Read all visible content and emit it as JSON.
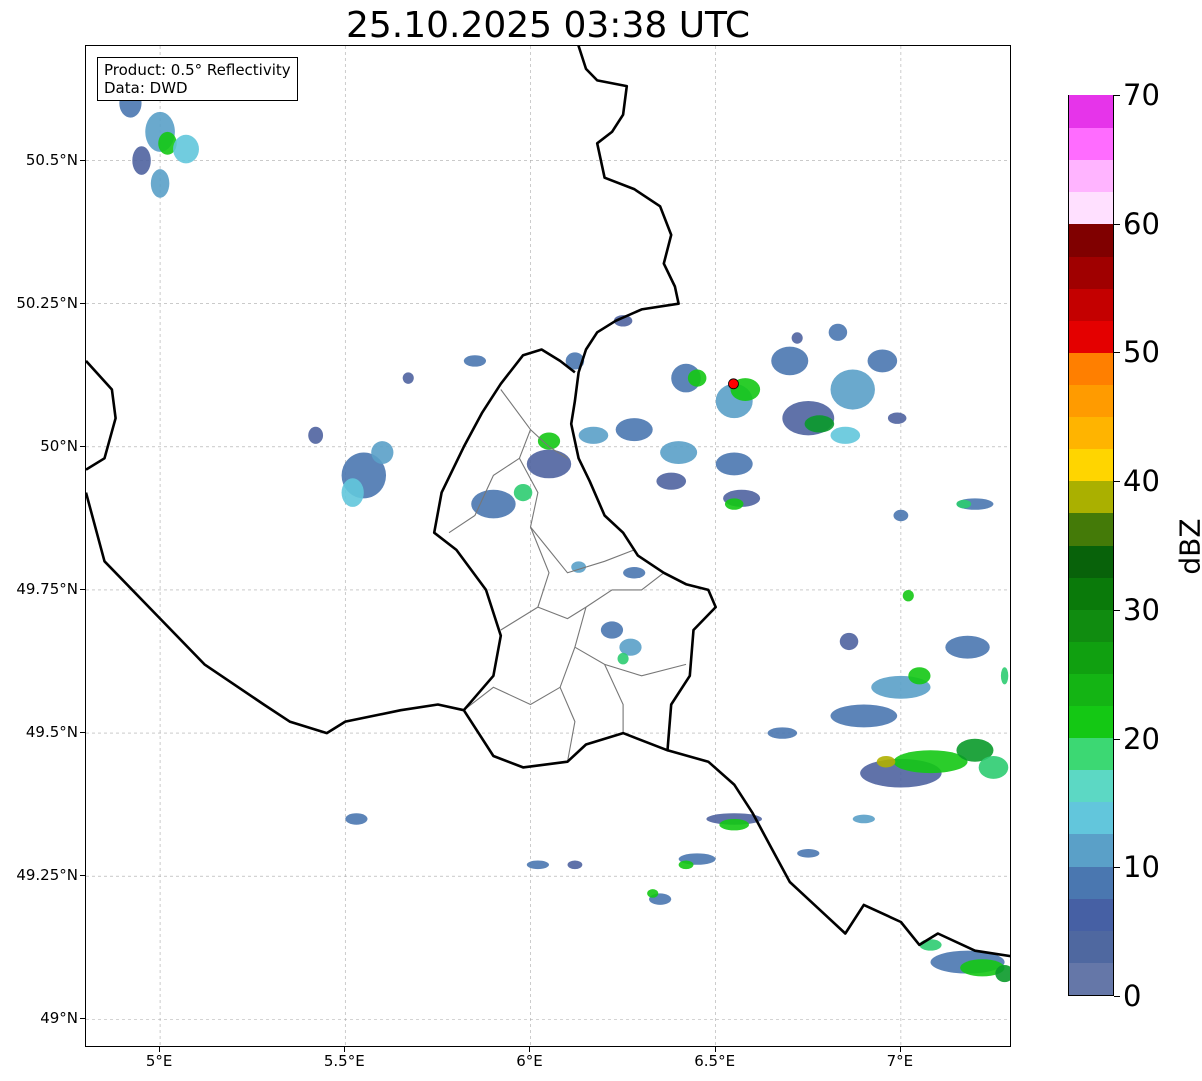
{
  "title": "25.10.2025 03:38 UTC",
  "info": {
    "product": "Product: 0.5° Reflectivity",
    "data": "Data: DWD"
  },
  "map": {
    "extent": {
      "lon_min": 4.8,
      "lon_max": 7.3,
      "lat_min": 48.95,
      "lat_max": 50.7
    },
    "lat_ticks": [
      {
        "value": 50.5,
        "label": "50.5°N"
      },
      {
        "value": 50.25,
        "label": "50.25°N"
      },
      {
        "value": 50.0,
        "label": "50°N"
      },
      {
        "value": 49.75,
        "label": "49.75°N"
      },
      {
        "value": 49.5,
        "label": "49.5°N"
      },
      {
        "value": 49.25,
        "label": "49.25°N"
      },
      {
        "value": 49.0,
        "label": "49°N"
      }
    ],
    "lon_ticks": [
      {
        "value": 5.0,
        "label": "5°E"
      },
      {
        "value": 5.5,
        "label": "5.5°E"
      },
      {
        "value": 6.0,
        "label": "6°E"
      },
      {
        "value": 6.5,
        "label": "6.5°E"
      },
      {
        "value": 7.0,
        "label": "7°E"
      }
    ],
    "gridlines": true,
    "radar_site": {
      "lon": 6.548,
      "lat": 50.11,
      "color": "#ff0000"
    },
    "national_borders": [
      [
        [
          6.12,
          50.72
        ],
        [
          6.15,
          50.66
        ],
        [
          6.18,
          50.64
        ],
        [
          6.26,
          50.63
        ],
        [
          6.25,
          50.58
        ],
        [
          6.22,
          50.55
        ],
        [
          6.18,
          50.53
        ],
        [
          6.2,
          50.47
        ],
        [
          6.28,
          50.45
        ],
        [
          6.35,
          50.42
        ],
        [
          6.38,
          50.37
        ],
        [
          6.36,
          50.32
        ],
        [
          6.39,
          50.28
        ],
        [
          6.4,
          50.25
        ],
        [
          6.3,
          50.24
        ],
        [
          6.23,
          50.22
        ],
        [
          6.18,
          50.2
        ],
        [
          6.15,
          50.17
        ],
        [
          6.13,
          50.13
        ],
        [
          6.12,
          50.08
        ],
        [
          6.11,
          50.04
        ],
        [
          6.13,
          49.98
        ],
        [
          6.16,
          49.94
        ],
        [
          6.2,
          49.88
        ],
        [
          6.25,
          49.85
        ],
        [
          6.29,
          49.81
        ],
        [
          6.36,
          49.78
        ],
        [
          6.42,
          49.76
        ],
        [
          6.48,
          49.75
        ],
        [
          6.5,
          49.72
        ],
        [
          6.44,
          49.68
        ],
        [
          6.43,
          49.6
        ],
        [
          6.38,
          49.55
        ],
        [
          6.37,
          49.47
        ],
        [
          6.25,
          49.5
        ],
        [
          6.15,
          49.48
        ],
        [
          6.1,
          49.45
        ],
        [
          5.98,
          49.44
        ],
        [
          5.9,
          49.46
        ],
        [
          5.82,
          49.54
        ],
        [
          5.75,
          49.55
        ],
        [
          5.65,
          49.54
        ],
        [
          5.5,
          49.52
        ],
        [
          5.45,
          49.5
        ],
        [
          5.35,
          49.52
        ],
        [
          5.28,
          49.55
        ],
        [
          5.12,
          49.62
        ],
        [
          5.0,
          49.7
        ],
        [
          4.85,
          49.8
        ],
        [
          4.8,
          49.92
        ]
      ],
      [
        [
          4.8,
          50.15
        ],
        [
          4.87,
          50.1
        ],
        [
          4.88,
          50.05
        ],
        [
          4.85,
          49.98
        ],
        [
          4.8,
          49.96
        ]
      ],
      [
        [
          5.82,
          49.54
        ],
        [
          5.9,
          49.6
        ],
        [
          5.92,
          49.67
        ],
        [
          5.88,
          49.75
        ],
        [
          5.8,
          49.82
        ],
        [
          5.74,
          49.85
        ],
        [
          5.76,
          49.92
        ],
        [
          5.82,
          50.0
        ],
        [
          5.87,
          50.06
        ],
        [
          5.92,
          50.11
        ],
        [
          5.98,
          50.16
        ],
        [
          6.03,
          50.17
        ],
        [
          6.08,
          50.15
        ],
        [
          6.12,
          50.13
        ]
      ],
      [
        [
          6.37,
          49.47
        ],
        [
          6.48,
          49.45
        ],
        [
          6.55,
          49.41
        ],
        [
          6.6,
          49.36
        ],
        [
          6.65,
          49.3
        ],
        [
          6.7,
          49.24
        ],
        [
          6.8,
          49.18
        ],
        [
          6.85,
          49.15
        ],
        [
          6.9,
          49.2
        ],
        [
          7.0,
          49.17
        ],
        [
          7.05,
          49.13
        ],
        [
          7.1,
          49.15
        ],
        [
          7.2,
          49.12
        ],
        [
          7.3,
          49.11
        ]
      ]
    ],
    "regional_borders": [
      [
        [
          5.92,
          50.1
        ],
        [
          6.0,
          50.03
        ],
        [
          5.97,
          49.98
        ],
        [
          5.9,
          49.95
        ],
        [
          5.85,
          49.88
        ],
        [
          5.78,
          49.85
        ]
      ],
      [
        [
          6.0,
          50.03
        ],
        [
          6.05,
          50.0
        ],
        [
          6.1,
          49.98
        ]
      ],
      [
        [
          5.97,
          49.98
        ],
        [
          6.02,
          49.92
        ],
        [
          6.0,
          49.86
        ],
        [
          6.05,
          49.82
        ],
        [
          6.1,
          49.78
        ],
        [
          6.2,
          49.8
        ],
        [
          6.28,
          49.82
        ]
      ],
      [
        [
          6.0,
          49.86
        ],
        [
          6.05,
          49.78
        ],
        [
          6.02,
          49.72
        ],
        [
          5.92,
          49.68
        ]
      ],
      [
        [
          6.02,
          49.72
        ],
        [
          6.1,
          49.7
        ],
        [
          6.15,
          49.72
        ],
        [
          6.22,
          49.75
        ],
        [
          6.3,
          49.75
        ],
        [
          6.36,
          49.78
        ]
      ],
      [
        [
          6.15,
          49.72
        ],
        [
          6.12,
          49.65
        ],
        [
          6.08,
          49.58
        ],
        [
          6.0,
          49.55
        ],
        [
          5.9,
          49.58
        ],
        [
          5.82,
          49.54
        ]
      ],
      [
        [
          6.12,
          49.65
        ],
        [
          6.2,
          49.62
        ],
        [
          6.3,
          49.6
        ],
        [
          6.42,
          49.62
        ]
      ],
      [
        [
          6.08,
          49.58
        ],
        [
          6.12,
          49.52
        ],
        [
          6.1,
          49.45
        ]
      ],
      [
        [
          6.2,
          49.62
        ],
        [
          6.25,
          49.55
        ],
        [
          6.25,
          49.5
        ]
      ]
    ],
    "echoes": [
      {
        "lon": 4.92,
        "lat": 50.6,
        "w": 0.06,
        "h": 0.05,
        "c": "#4a77b0"
      },
      {
        "lon": 5.0,
        "lat": 50.55,
        "w": 0.08,
        "h": 0.07,
        "c": "#5aa0c8"
      },
      {
        "lon": 5.02,
        "lat": 50.53,
        "w": 0.05,
        "h": 0.04,
        "c": "#14c814"
      },
      {
        "lon": 5.07,
        "lat": 50.52,
        "w": 0.07,
        "h": 0.05,
        "c": "#62c6dc"
      },
      {
        "lon": 4.95,
        "lat": 50.5,
        "w": 0.05,
        "h": 0.05,
        "c": "#4f63a0"
      },
      {
        "lon": 5.0,
        "lat": 50.46,
        "w": 0.05,
        "h": 0.05,
        "c": "#5aa0c8"
      },
      {
        "lon": 5.55,
        "lat": 49.95,
        "w": 0.12,
        "h": 0.08,
        "c": "#4a77b0"
      },
      {
        "lon": 5.52,
        "lat": 49.92,
        "w": 0.06,
        "h": 0.05,
        "c": "#62c6dc"
      },
      {
        "lon": 5.6,
        "lat": 49.99,
        "w": 0.06,
        "h": 0.04,
        "c": "#5aa0c8"
      },
      {
        "lon": 5.42,
        "lat": 50.02,
        "w": 0.04,
        "h": 0.03,
        "c": "#4f63a0"
      },
      {
        "lon": 5.85,
        "lat": 50.15,
        "w": 0.06,
        "h": 0.02,
        "c": "#4a77b0"
      },
      {
        "lon": 5.67,
        "lat": 50.12,
        "w": 0.03,
        "h": 0.02,
        "c": "#4f63a0"
      },
      {
        "lon": 5.9,
        "lat": 49.9,
        "w": 0.12,
        "h": 0.05,
        "c": "#4a77b0"
      },
      {
        "lon": 5.98,
        "lat": 49.92,
        "w": 0.05,
        "h": 0.03,
        "c": "#2ecc71"
      },
      {
        "lon": 6.05,
        "lat": 49.97,
        "w": 0.12,
        "h": 0.05,
        "c": "#4f63a0"
      },
      {
        "lon": 6.05,
        "lat": 50.01,
        "w": 0.06,
        "h": 0.03,
        "c": "#14c814"
      },
      {
        "lon": 6.17,
        "lat": 50.02,
        "w": 0.08,
        "h": 0.03,
        "c": "#5aa0c8"
      },
      {
        "lon": 6.12,
        "lat": 50.15,
        "w": 0.05,
        "h": 0.03,
        "c": "#4a77b0"
      },
      {
        "lon": 6.25,
        "lat": 50.22,
        "w": 0.05,
        "h": 0.02,
        "c": "#4f63a0"
      },
      {
        "lon": 6.28,
        "lat": 50.03,
        "w": 0.1,
        "h": 0.04,
        "c": "#4a77b0"
      },
      {
        "lon": 6.4,
        "lat": 49.99,
        "w": 0.1,
        "h": 0.04,
        "c": "#5aa0c8"
      },
      {
        "lon": 6.38,
        "lat": 49.94,
        "w": 0.08,
        "h": 0.03,
        "c": "#4f63a0"
      },
      {
        "lon": 6.55,
        "lat": 49.97,
        "w": 0.1,
        "h": 0.04,
        "c": "#4a77b0"
      },
      {
        "lon": 6.57,
        "lat": 49.91,
        "w": 0.1,
        "h": 0.03,
        "c": "#4f63a0"
      },
      {
        "lon": 6.55,
        "lat": 49.9,
        "w": 0.05,
        "h": 0.02,
        "c": "#14c814"
      },
      {
        "lon": 6.42,
        "lat": 50.12,
        "w": 0.08,
        "h": 0.05,
        "c": "#4a77b0"
      },
      {
        "lon": 6.45,
        "lat": 50.12,
        "w": 0.05,
        "h": 0.03,
        "c": "#14c814"
      },
      {
        "lon": 6.55,
        "lat": 50.08,
        "w": 0.1,
        "h": 0.06,
        "c": "#5aa0c8"
      },
      {
        "lon": 6.58,
        "lat": 50.1,
        "w": 0.08,
        "h": 0.04,
        "c": "#14c814"
      },
      {
        "lon": 6.7,
        "lat": 50.15,
        "w": 0.1,
        "h": 0.05,
        "c": "#4a77b0"
      },
      {
        "lon": 6.75,
        "lat": 50.05,
        "w": 0.14,
        "h": 0.06,
        "c": "#4f63a0"
      },
      {
        "lon": 6.78,
        "lat": 50.04,
        "w": 0.08,
        "h": 0.03,
        "c": "#0a9a2a"
      },
      {
        "lon": 6.87,
        "lat": 50.1,
        "w": 0.12,
        "h": 0.07,
        "c": "#5aa0c8"
      },
      {
        "lon": 6.85,
        "lat": 50.02,
        "w": 0.08,
        "h": 0.03,
        "c": "#62c6dc"
      },
      {
        "lon": 6.95,
        "lat": 50.15,
        "w": 0.08,
        "h": 0.04,
        "c": "#4a77b0"
      },
      {
        "lon": 6.99,
        "lat": 50.05,
        "w": 0.05,
        "h": 0.02,
        "c": "#4f63a0"
      },
      {
        "lon": 6.28,
        "lat": 49.78,
        "w": 0.06,
        "h": 0.02,
        "c": "#4a77b0"
      },
      {
        "lon": 6.13,
        "lat": 49.79,
        "w": 0.04,
        "h": 0.02,
        "c": "#5aa0c8"
      },
      {
        "lon": 6.22,
        "lat": 49.68,
        "w": 0.06,
        "h": 0.03,
        "c": "#4a77b0"
      },
      {
        "lon": 6.27,
        "lat": 49.65,
        "w": 0.06,
        "h": 0.03,
        "c": "#5aa0c8"
      },
      {
        "lon": 6.25,
        "lat": 49.63,
        "w": 0.03,
        "h": 0.02,
        "c": "#2ecc71"
      },
      {
        "lon": 6.9,
        "lat": 49.53,
        "w": 0.18,
        "h": 0.04,
        "c": "#4a77b0"
      },
      {
        "lon": 7.0,
        "lat": 49.58,
        "w": 0.16,
        "h": 0.04,
        "c": "#5aa0c8"
      },
      {
        "lon": 7.05,
        "lat": 49.6,
        "w": 0.06,
        "h": 0.03,
        "c": "#14c814"
      },
      {
        "lon": 7.18,
        "lat": 49.65,
        "w": 0.12,
        "h": 0.04,
        "c": "#4a77b0"
      },
      {
        "lon": 6.86,
        "lat": 49.66,
        "w": 0.05,
        "h": 0.03,
        "c": "#4f63a0"
      },
      {
        "lon": 7.0,
        "lat": 49.43,
        "w": 0.22,
        "h": 0.05,
        "c": "#4f63a0"
      },
      {
        "lon": 7.08,
        "lat": 49.45,
        "w": 0.2,
        "h": 0.04,
        "c": "#14c814"
      },
      {
        "lon": 7.2,
        "lat": 49.47,
        "w": 0.1,
        "h": 0.04,
        "c": "#0a9a2a"
      },
      {
        "lon": 6.96,
        "lat": 49.45,
        "w": 0.05,
        "h": 0.02,
        "c": "#b0b000"
      },
      {
        "lon": 7.25,
        "lat": 49.44,
        "w": 0.08,
        "h": 0.04,
        "c": "#2ecc71"
      },
      {
        "lon": 6.68,
        "lat": 49.5,
        "w": 0.08,
        "h": 0.02,
        "c": "#4a77b0"
      },
      {
        "lon": 6.55,
        "lat": 49.35,
        "w": 0.15,
        "h": 0.02,
        "c": "#4f63a0"
      },
      {
        "lon": 6.55,
        "lat": 49.34,
        "w": 0.08,
        "h": 0.02,
        "c": "#14c814"
      },
      {
        "lon": 6.45,
        "lat": 49.28,
        "w": 0.1,
        "h": 0.02,
        "c": "#4a77b0"
      },
      {
        "lon": 6.42,
        "lat": 49.27,
        "w": 0.04,
        "h": 0.015,
        "c": "#14c814"
      },
      {
        "lon": 6.35,
        "lat": 49.21,
        "w": 0.06,
        "h": 0.02,
        "c": "#4a77b0"
      },
      {
        "lon": 6.33,
        "lat": 49.22,
        "w": 0.03,
        "h": 0.015,
        "c": "#14c814"
      },
      {
        "lon": 6.75,
        "lat": 49.29,
        "w": 0.06,
        "h": 0.015,
        "c": "#4a77b0"
      },
      {
        "lon": 6.9,
        "lat": 49.35,
        "w": 0.06,
        "h": 0.015,
        "c": "#5aa0c8"
      },
      {
        "lon": 7.18,
        "lat": 49.1,
        "w": 0.2,
        "h": 0.04,
        "c": "#4a77b0"
      },
      {
        "lon": 7.22,
        "lat": 49.09,
        "w": 0.12,
        "h": 0.03,
        "c": "#14c814"
      },
      {
        "lon": 7.28,
        "lat": 49.08,
        "w": 0.05,
        "h": 0.03,
        "c": "#0a9a2a"
      },
      {
        "lon": 7.08,
        "lat": 49.13,
        "w": 0.06,
        "h": 0.02,
        "c": "#2ecc71"
      },
      {
        "lon": 5.53,
        "lat": 49.35,
        "w": 0.06,
        "h": 0.02,
        "c": "#4a77b0"
      },
      {
        "lon": 6.02,
        "lat": 49.27,
        "w": 0.06,
        "h": 0.015,
        "c": "#4a77b0"
      },
      {
        "lon": 6.12,
        "lat": 49.27,
        "w": 0.04,
        "h": 0.015,
        "c": "#4f63a0"
      },
      {
        "lon": 7.02,
        "lat": 49.74,
        "w": 0.03,
        "h": 0.02,
        "c": "#14c814"
      },
      {
        "lon": 7.2,
        "lat": 49.9,
        "w": 0.1,
        "h": 0.02,
        "c": "#4a77b0"
      },
      {
        "lon": 7.17,
        "lat": 49.9,
        "w": 0.04,
        "h": 0.015,
        "c": "#2ecc71"
      },
      {
        "lon": 7.0,
        "lat": 49.88,
        "w": 0.04,
        "h": 0.02,
        "c": "#4a77b0"
      },
      {
        "lon": 7.28,
        "lat": 49.6,
        "w": 0.02,
        "h": 0.03,
        "c": "#2ecc71"
      },
      {
        "lon": 6.72,
        "lat": 50.19,
        "w": 0.03,
        "h": 0.02,
        "c": "#4f63a0"
      },
      {
        "lon": 6.83,
        "lat": 50.2,
        "w": 0.05,
        "h": 0.03,
        "c": "#4a77b0"
      }
    ]
  },
  "colorbar": {
    "label": "dBZ",
    "min": 0,
    "max": 70,
    "ticks": [
      {
        "value": 0,
        "label": "0"
      },
      {
        "value": 10,
        "label": "10"
      },
      {
        "value": 20,
        "label": "20"
      },
      {
        "value": 30,
        "label": "30"
      },
      {
        "value": 40,
        "label": "40"
      },
      {
        "value": 50,
        "label": "50"
      },
      {
        "value": 60,
        "label": "60"
      },
      {
        "value": 70,
        "label": "70"
      }
    ],
    "colors": [
      "#6577a8",
      "#4f68a0",
      "#4660a4",
      "#4a77b0",
      "#5aa0c8",
      "#62c6dc",
      "#5cd8c4",
      "#3cd873",
      "#14c814",
      "#14b414",
      "#10a010",
      "#108c10",
      "#0a7a0a",
      "#08620a",
      "#447a08",
      "#aab000",
      "#ffd500",
      "#ffb400",
      "#ff9b00",
      "#ff7f00",
      "#e40000",
      "#c40000",
      "#a00000",
      "#800000",
      "#ffe0ff",
      "#ffb4ff",
      "#ff6cff",
      "#e634ea"
    ]
  }
}
